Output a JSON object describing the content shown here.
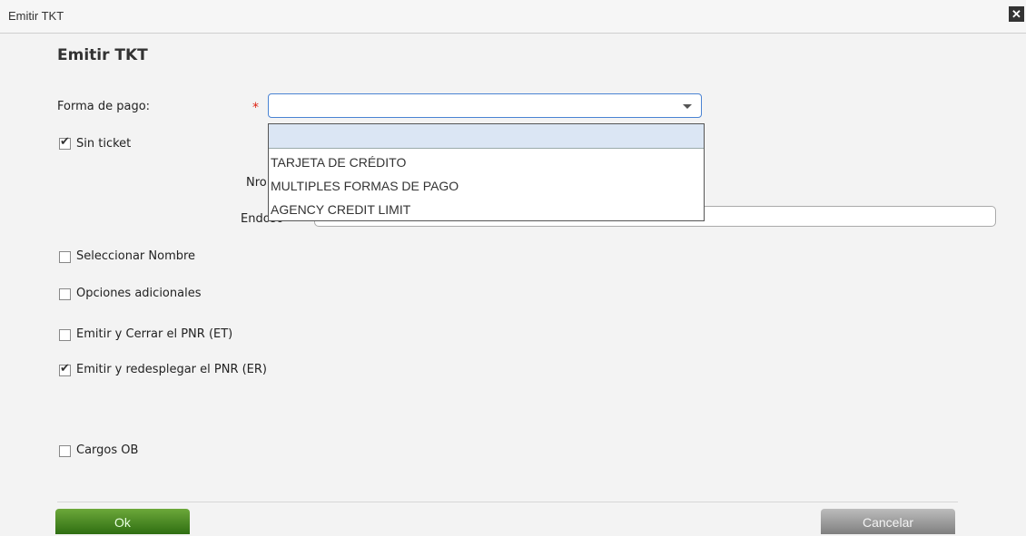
{
  "window": {
    "title": "Emitir TKT",
    "close_glyph": "✕"
  },
  "dialog": {
    "heading": "Emitir TKT"
  },
  "forma_pago": {
    "label": "Forma de pago:",
    "required_mark": "*",
    "value": "",
    "options": [
      "",
      "TARJETA DE CRÉDITO",
      "MULTIPLES FORMAS DE PAGO",
      "AGENCY CREDIT LIMIT"
    ]
  },
  "hidden_labels": {
    "nro": "Nro",
    "endoso": "Endoso"
  },
  "checkboxes": {
    "sin_ticket": {
      "label": "Sin ticket",
      "checked": true
    },
    "seleccionar_nombre": {
      "label": "Seleccionar Nombre",
      "checked": false
    },
    "opciones_adicionales": {
      "label": "Opciones adicionales",
      "checked": false
    },
    "emitir_cerrar": {
      "label": "Emitir y Cerrar el PNR (ET)",
      "checked": false
    },
    "emitir_redesplegar": {
      "label": "Emitir y redesplegar el PNR (ER)",
      "checked": true
    },
    "cargos_ob": {
      "label": "Cargos OB",
      "checked": false
    }
  },
  "buttons": {
    "ok": "Ok",
    "cancel": "Cancelar"
  }
}
